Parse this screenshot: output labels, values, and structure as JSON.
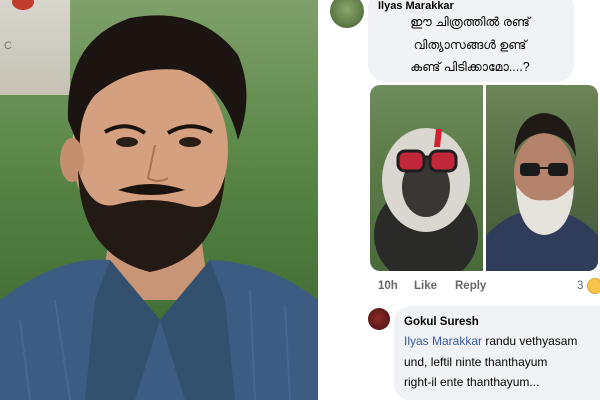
{
  "photo": {
    "sign_text": "C"
  },
  "comment": {
    "author": "Ilyas Marakkar",
    "lines": [
      "ഈ ചിത്രത്തിൽ രണ്ട്",
      "വിത്യാസങ്ങൾ ഉണ്ട്",
      "കണ്ട് പിടിക്കാമോ....?"
    ],
    "time": "10h",
    "like_label": "Like",
    "reply_label": "Reply",
    "reaction_count": "3"
  },
  "reply": {
    "author": "Gokul Suresh",
    "mention": "Ilyas Marakkar",
    "line1_rest": " randu vethyasam",
    "line2": "und, leftil ninte thanthayum",
    "line3": "right-il ente thanthayum..."
  },
  "colors": {
    "bubble": "#f0f2f5",
    "mention": "#385898",
    "meta": "#65676b"
  },
  "icons": {
    "reaction": "haha-emoji-icon"
  }
}
